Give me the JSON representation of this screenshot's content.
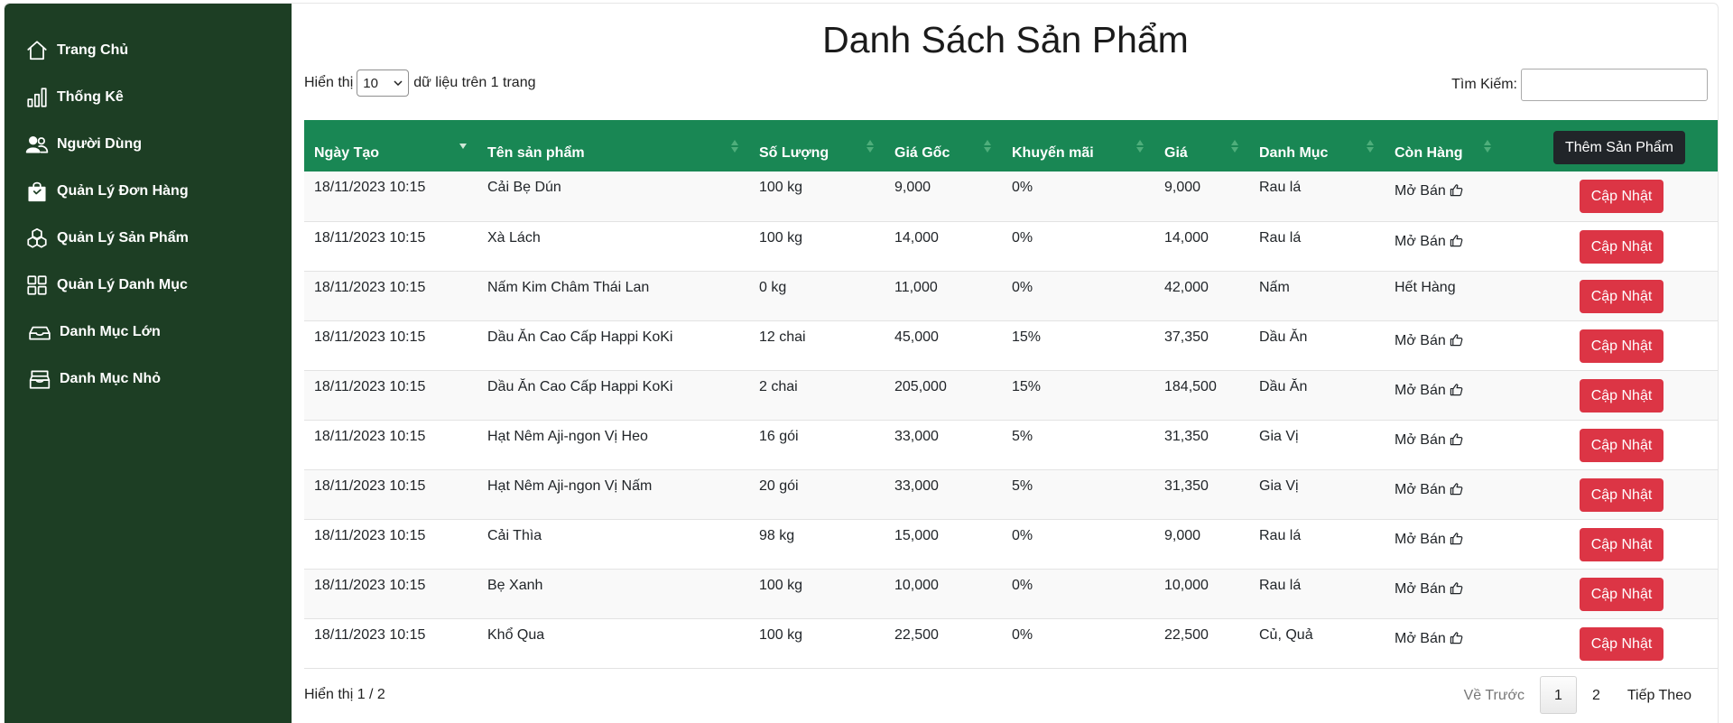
{
  "sidebar": {
    "items": [
      {
        "label": "Trang Chủ",
        "icon": "house-icon"
      },
      {
        "label": "Thống Kê",
        "icon": "bar-chart-icon"
      },
      {
        "label": "Người Dùng",
        "icon": "people-icon"
      },
      {
        "label": "Quản Lý Đơn Hàng",
        "icon": "shopping-bag-icon"
      },
      {
        "label": "Quản Lý Sản Phẩm",
        "icon": "boxes-icon"
      },
      {
        "label": "Quản Lý Danh Mục",
        "icon": "grid-icon"
      },
      {
        "label": "Danh Mục Lớn",
        "icon": "box-icon"
      },
      {
        "label": "Danh Mục Nhỏ",
        "icon": "box-seam-icon"
      }
    ]
  },
  "page": {
    "title": "Danh Sách Sản Phẩm",
    "length_prefix": "Hiển thị",
    "length_value": "10",
    "length_suffix": "dữ liệu trên 1 trang",
    "search_label": "Tìm Kiếm:",
    "search_value": "",
    "add_button": "Thêm Sản Phẩm",
    "update_button": "Cập Nhật",
    "info": "Hiển thị 1 / 2"
  },
  "table": {
    "columns": [
      "Ngày Tạo",
      "Tên sản phẩm",
      "Số Lượng",
      "Giá Gốc",
      "Khuyến mãi",
      "Giá",
      "Danh Mục",
      "Còn Hàng"
    ],
    "rows": [
      {
        "date": "18/11/2023 10:15",
        "name": "Cải Bẹ Dún",
        "qty": "100 kg",
        "base": "9,000",
        "promo": "0%",
        "price": "9,000",
        "cat": "Rau lá",
        "stock": "Mở Bán",
        "open": true
      },
      {
        "date": "18/11/2023 10:15",
        "name": "Xà Lách",
        "qty": "100 kg",
        "base": "14,000",
        "promo": "0%",
        "price": "14,000",
        "cat": "Rau lá",
        "stock": "Mở Bán",
        "open": true
      },
      {
        "date": "18/11/2023 10:15",
        "name": "Nấm Kim Châm Thái Lan",
        "qty": "0 kg",
        "base": "11,000",
        "promo": "0%",
        "price": "42,000",
        "cat": "Nấm",
        "stock": "Hết Hàng",
        "open": false
      },
      {
        "date": "18/11/2023 10:15",
        "name": "Dầu Ăn Cao Cấp Happi KoKi",
        "qty": "12 chai",
        "base": "45,000",
        "promo": "15%",
        "price": "37,350",
        "cat": "Dầu Ăn",
        "stock": "Mở Bán",
        "open": true
      },
      {
        "date": "18/11/2023 10:15",
        "name": "Dầu Ăn Cao Cấp Happi KoKi",
        "qty": "2 chai",
        "base": "205,000",
        "promo": "15%",
        "price": "184,500",
        "cat": "Dầu Ăn",
        "stock": "Mở Bán",
        "open": true
      },
      {
        "date": "18/11/2023 10:15",
        "name": "Hạt Nêm Aji-ngon Vị Heo",
        "qty": "16 gói",
        "base": "33,000",
        "promo": "5%",
        "price": "31,350",
        "cat": "Gia Vị",
        "stock": "Mở Bán",
        "open": true
      },
      {
        "date": "18/11/2023 10:15",
        "name": "Hạt Nêm Aji-ngon Vị Nấm",
        "qty": "20 gói",
        "base": "33,000",
        "promo": "5%",
        "price": "31,350",
        "cat": "Gia Vị",
        "stock": "Mở Bán",
        "open": true
      },
      {
        "date": "18/11/2023 10:15",
        "name": "Cải Thìa",
        "qty": "98 kg",
        "base": "15,000",
        "promo": "0%",
        "price": "9,000",
        "cat": "Rau lá",
        "stock": "Mở Bán",
        "open": true
      },
      {
        "date": "18/11/2023 10:15",
        "name": "Bẹ Xanh",
        "qty": "100 kg",
        "base": "10,000",
        "promo": "0%",
        "price": "10,000",
        "cat": "Rau lá",
        "stock": "Mở Bán",
        "open": true
      },
      {
        "date": "18/11/2023 10:15",
        "name": "Khổ Qua",
        "qty": "100 kg",
        "base": "22,500",
        "promo": "0%",
        "price": "22,500",
        "cat": "Củ, Quả",
        "stock": "Mở Bán",
        "open": true
      }
    ]
  },
  "pagination": {
    "prev": "Về Trước",
    "pages": [
      "1",
      "2"
    ],
    "current": "1",
    "next": "Tiếp Theo"
  },
  "colors": {
    "sidebar_bg": "#1d3e24",
    "header_bg": "#198754",
    "update_button": "#dc3545",
    "add_button": "#212529"
  }
}
